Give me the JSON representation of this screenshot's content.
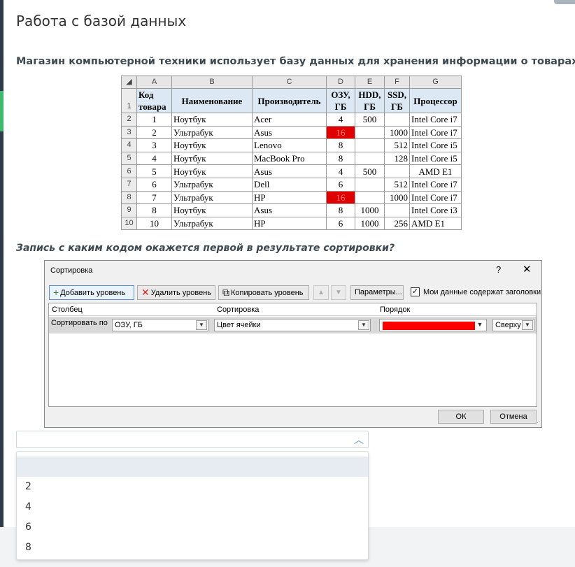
{
  "page_title": "Работа с базой данных",
  "question": "Магазин компьютерной техники использует базу данных для хранения информации о товарах.",
  "question2": "Запись с каким кодом окажется первой в результате сортировки?",
  "sheet": {
    "columns": [
      "A",
      "B",
      "C",
      "D",
      "E",
      "F",
      "G"
    ],
    "headers": {
      "A1": "Код",
      "A2": "товара",
      "B": "Наименование",
      "C": "Производитель",
      "D1": "ОЗУ,",
      "D2": "ГБ",
      "E1": "HDD,",
      "E2": "ГБ",
      "F1": "SSD,",
      "F2": "ГБ",
      "G": "Процессор"
    },
    "rows": [
      {
        "n": "2",
        "code": "1",
        "name": "Ноутбук",
        "maker": "Acer",
        "ram": "4",
        "hdd": "500",
        "ssd": "",
        "cpu": "Intel Core i7"
      },
      {
        "n": "3",
        "code": "2",
        "name": "Ультрабук",
        "maker": "Asus",
        "ram": "16",
        "hdd": "",
        "ssd": "1000",
        "cpu": "Intel Core i7"
      },
      {
        "n": "4",
        "code": "3",
        "name": "Ноутбук",
        "maker": "Lenovo",
        "ram": "8",
        "hdd": "",
        "ssd": "512",
        "cpu": "Intel Core i5"
      },
      {
        "n": "5",
        "code": "4",
        "name": "Ноутбук",
        "maker": "MacBook Pro",
        "ram": "8",
        "hdd": "",
        "ssd": "128",
        "cpu": "Intel Core i5"
      },
      {
        "n": "6",
        "code": "5",
        "name": "Ноутбук",
        "maker": "Asus",
        "ram": "4",
        "hdd": "500",
        "ssd": "",
        "cpu": "AMD E1"
      },
      {
        "n": "7",
        "code": "6",
        "name": "Ультрабук",
        "maker": "Dell",
        "ram": "6",
        "hdd": "",
        "ssd": "512",
        "cpu": "Intel Core i7"
      },
      {
        "n": "8",
        "code": "7",
        "name": "Ультрабук",
        "maker": "HP",
        "ram": "16",
        "hdd": "",
        "ssd": "1000",
        "cpu": "Intel Core i7"
      },
      {
        "n": "9",
        "code": "8",
        "name": "Ноутбук",
        "maker": "Asus",
        "ram": "8",
        "hdd": "1000",
        "ssd": "",
        "cpu": "Intel Core i3"
      },
      {
        "n": "10",
        "code": "10",
        "name": "Ультрабук",
        "maker": "HP",
        "ram": "6",
        "hdd": "1000",
        "ssd": "256",
        "cpu": "AMD E1"
      }
    ],
    "highlight_color": "#e00000"
  },
  "dialog": {
    "title": "Сортировка",
    "help": "?",
    "close": "✕",
    "add_level": "Добавить уровень",
    "delete_level": "Удалить уровень",
    "copy_level": "Копировать уровень",
    "params": "Параметры...",
    "has_headers": "Мои данные содержат заголовки",
    "col_column": "Столбец",
    "col_sort": "Сортировка",
    "col_order": "Порядок",
    "sort_by": "Сортировать по",
    "column_value": "ОЗУ, ГБ",
    "sort_value": "Цвет ячейки",
    "order_color": "#ff0000",
    "position_value": "Сверху",
    "ok": "ОК",
    "cancel": "Отмена"
  },
  "answer_select": {
    "value": "",
    "options": [
      "",
      "2",
      "4",
      "6",
      "8"
    ]
  }
}
